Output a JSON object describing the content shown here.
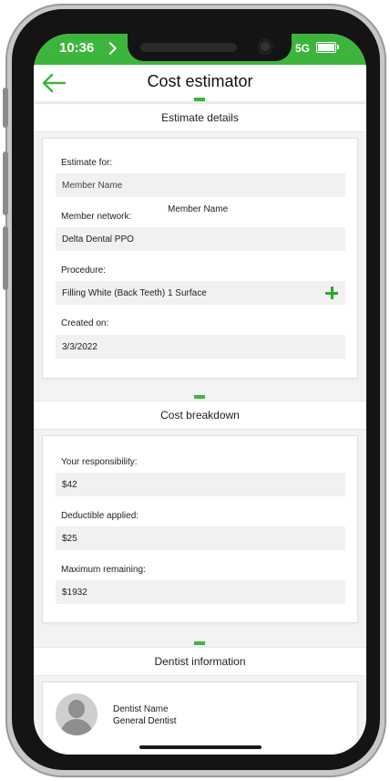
{
  "status": {
    "time": "10:36",
    "network": "5G"
  },
  "appbar": {
    "title": "Cost estimator"
  },
  "estimate": {
    "heading": "Estimate details",
    "estimate_for_label": "Estimate for:",
    "estimate_for_value": "Member Name",
    "floating_member_name": "Member Name",
    "network_label": "Member network:",
    "network_value": "Delta Dental PPO",
    "procedure_label": "Procedure:",
    "procedure_value": "Filling White (Back Teeth) 1 Surface",
    "created_label": "Created on:",
    "created_value": "3/3/2022"
  },
  "cost": {
    "heading": "Cost breakdown",
    "responsibility_label": "Your responsibility:",
    "responsibility_value": "$42",
    "deductible_label": "Deductible applied:",
    "deductible_value": "$25",
    "maximum_label": "Maximum remaining:",
    "maximum_value": "$1932"
  },
  "dentist": {
    "heading": "Dentist information",
    "name": "Dentist Name",
    "role": "General Dentist"
  },
  "colors": {
    "accent": "#3db53d",
    "plus": "#2da82d"
  },
  "icons": {
    "back": "arrow-left-icon",
    "add": "plus-icon",
    "avatar": "person-avatar-icon"
  }
}
